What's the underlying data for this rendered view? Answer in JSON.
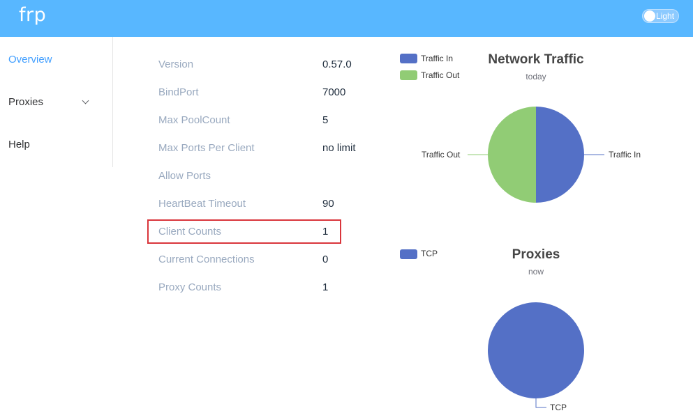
{
  "header": {
    "brand": "frp",
    "theme_toggle_label": "Light"
  },
  "sidebar": {
    "items": [
      {
        "label": "Overview",
        "active": true
      },
      {
        "label": "Proxies",
        "has_submenu": true
      },
      {
        "label": "Help"
      }
    ]
  },
  "server_info": [
    {
      "key": "Version",
      "value": "0.57.0"
    },
    {
      "key": "BindPort",
      "value": "7000"
    },
    {
      "key": "Max PoolCount",
      "value": "5"
    },
    {
      "key": "Max Ports Per Client",
      "value": "no limit"
    },
    {
      "key": "Allow Ports",
      "value": ""
    },
    {
      "key": "HeartBeat Timeout",
      "value": "90"
    },
    {
      "key": "Client Counts",
      "value": "1"
    },
    {
      "key": "Current Connections",
      "value": "0"
    },
    {
      "key": "Proxy Counts",
      "value": "1"
    }
  ],
  "highlighted_row": "Client Counts",
  "colors": {
    "header": "#58b7ff",
    "active_menu": "#409eff",
    "traffic_in": "#5470c6",
    "traffic_out": "#91cc75",
    "highlight_box": "#d9353b"
  },
  "chart_data": [
    {
      "type": "pie",
      "title": "Network Traffic",
      "subtitle": "today",
      "legend": [
        "Traffic In",
        "Traffic Out"
      ],
      "legend_position": "top-left",
      "slices": [
        {
          "name": "Traffic In",
          "value": 50,
          "color": "#5470c6"
        },
        {
          "name": "Traffic Out",
          "value": 50,
          "color": "#91cc75"
        }
      ]
    },
    {
      "type": "pie",
      "title": "Proxies",
      "subtitle": "now",
      "legend": [
        "TCP"
      ],
      "legend_position": "top-left",
      "slices": [
        {
          "name": "TCP",
          "value": 1,
          "color": "#5470c6"
        }
      ]
    }
  ]
}
